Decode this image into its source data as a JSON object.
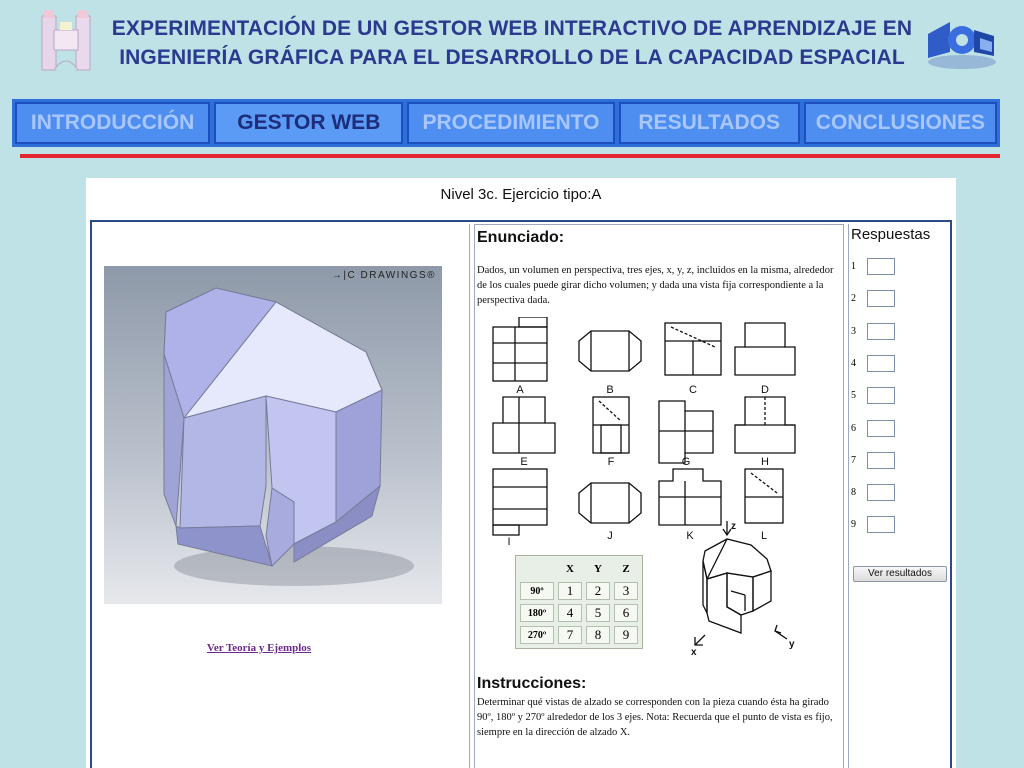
{
  "header": {
    "title_line1": "EXPERIMENTACIÓN DE UN GESTOR WEB INTERACTIVO DE APRENDIZAJE EN",
    "title_line2": "INGENIERÍA GRÁFICA PARA EL DESARROLLO DE LA CAPACIDAD ESPACIAL"
  },
  "nav": {
    "items": [
      {
        "label": "INTRODUCCIÓN"
      },
      {
        "label": "GESTOR WEB"
      },
      {
        "label": "PROCEDIMIENTO"
      },
      {
        "label": "RESULTADOS"
      },
      {
        "label": "CONCLUSIONES"
      }
    ],
    "active_index": 1
  },
  "panel": {
    "title": "Nivel 3c. Ejercicio tipo:A",
    "left": {
      "brand": "DRAWINGS®",
      "brand_prefix": "→|C",
      "theory_link": "Ver Teoría y Ejemplos"
    },
    "middle": {
      "enunciado_heading": "Enunciado:",
      "enunciado_text": "Dados, un volumen en perspectiva, tres ejes, x, y, z, incluidos en la misma, alrededor de los cuales puede girar dicho volumen; y dada una vista fija correspondiente a la perspectiva dada.",
      "view_labels": [
        "A",
        "B",
        "C",
        "D",
        "E",
        "F",
        "G",
        "H",
        "I",
        "J",
        "K",
        "L"
      ],
      "table": {
        "headers": [
          "X",
          "Y",
          "Z"
        ],
        "rows": [
          {
            "label": "90º",
            "values": [
              "1",
              "2",
              "3"
            ]
          },
          {
            "label": "180º",
            "values": [
              "4",
              "5",
              "6"
            ]
          },
          {
            "label": "270º",
            "values": [
              "7",
              "8",
              "9"
            ]
          }
        ]
      },
      "axes": {
        "z": "z",
        "x": "x",
        "y": "y"
      },
      "instrucciones_heading": "Instrucciones:",
      "instrucciones_text": "Determinar qué vistas de alzado se corresponden con la pieza cuando ésta ha girado 90º, 180º y 270º alrededor de los 3 ejes. Nota: Recuerda que el punto de vista es fijo, siempre en la dirección de alzado X."
    },
    "right": {
      "title": "Respuestas",
      "rows": [
        "1",
        "2",
        "3",
        "4",
        "5",
        "6",
        "7",
        "8",
        "9"
      ],
      "button_label": "Ver resultados"
    }
  },
  "colors": {
    "background": "#bfe2e6",
    "title": "#2b3a8f",
    "nav": "#4e8ef0",
    "accent_line": "#e3262f",
    "link": "#6b2a8c"
  }
}
